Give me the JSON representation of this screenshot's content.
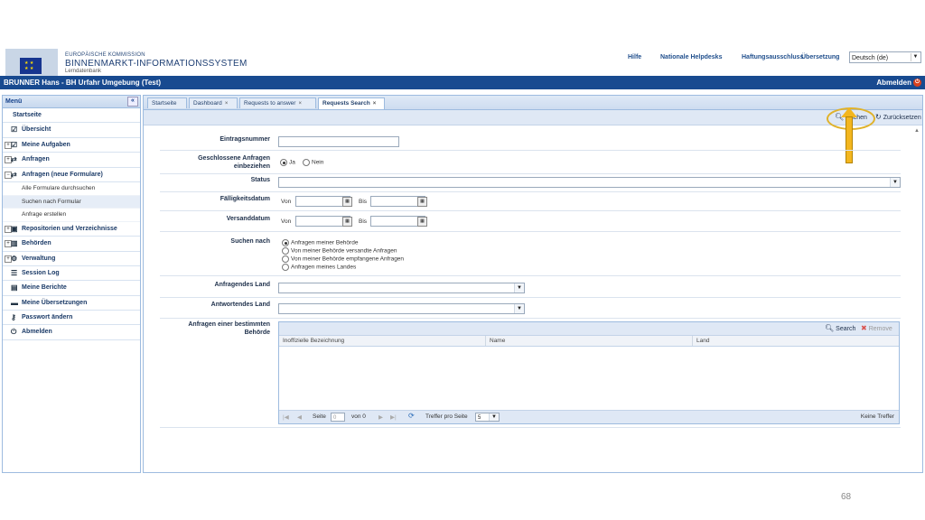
{
  "header": {
    "org_line1": "EUROPÄISCHE KOMMISSION",
    "org_line2": "BINNENMARKT-INFORMATIONSSYSTEM",
    "org_line3": "Lerndatenbank",
    "links": [
      "Hilfe",
      "Nationale Helpdesks",
      "Haftungsausschluss",
      "Übersetzung"
    ],
    "language": "Deutsch (de)"
  },
  "userbar": {
    "user": "BRUNNER Hans - BH Urfahr Umgebung (Test)",
    "logout": "Abmelden"
  },
  "sidebar": {
    "title": "Menü",
    "items": [
      {
        "label": "Startseite",
        "icon": "none"
      },
      {
        "label": "Übersicht",
        "icon": "checklist-icon"
      },
      {
        "label": "Meine Aufgaben",
        "icon": "checklist-icon"
      },
      {
        "label": "Anfragen",
        "icon": "exchange-icon"
      },
      {
        "label": "Anfragen (neue Formulare)",
        "icon": "exchange-icon"
      }
    ],
    "sub_items": [
      "Alle Formulare durchsuchen",
      "Suchen nach Formular",
      "Anfrage erstellen"
    ],
    "items2": [
      {
        "label": "Repositorien und Verzeichnisse",
        "icon": "briefcase-icon"
      },
      {
        "label": "Behörden",
        "icon": "building-icon"
      },
      {
        "label": "Verwaltung",
        "icon": "gear-icon"
      },
      {
        "label": "Session Log",
        "icon": "list-icon"
      },
      {
        "label": "Meine Berichte",
        "icon": "report-icon"
      },
      {
        "label": "Meine Übersetzungen",
        "icon": "chat-icon"
      },
      {
        "label": "Passwort ändern",
        "icon": "key-icon"
      },
      {
        "label": "Abmelden",
        "icon": "power-icon"
      }
    ]
  },
  "tabs": [
    "Startseite",
    "Dashboard",
    "Requests to answer",
    "Requests Search"
  ],
  "toolbar": {
    "search": "Suchen",
    "reset": "Zurücksetzen"
  },
  "form": {
    "eintragsnummer": "Eintragsnummer",
    "geschlossene_line1": "Geschlossene Anfragen",
    "geschlossene_line2": "einbeziehen",
    "ja": "Ja",
    "nein": "Nein",
    "status": "Status",
    "faelligkeitsdatum": "Fälligkeitsdatum",
    "versanddatum": "Versanddatum",
    "von": "Von",
    "bis": "Bis",
    "suchen_nach": "Suchen nach",
    "suchen_options": [
      "Anfragen meiner Behörde",
      "Von meiner Behörde versandte Anfragen",
      "Von meiner Behörde empfangene Anfragen",
      "Anfragen meines Landes"
    ],
    "anfragendes_land": "Anfragendes Land",
    "antwortendes_land": "Antwortendes Land",
    "bestimmte_line1": "Anfragen einer bestimmten",
    "bestimmte_line2": "Behörde"
  },
  "grid": {
    "search": "Search",
    "remove": "Remove",
    "columns": [
      "Inoffizielle Bezeichnung",
      "Name",
      "Land"
    ],
    "pager": {
      "seite": "Seite",
      "page": "0",
      "von": "von 0",
      "per_page_label": "Treffer pro Seite",
      "per_page": "5",
      "no_hits": "Keine Treffer"
    }
  },
  "slide_page": "68"
}
